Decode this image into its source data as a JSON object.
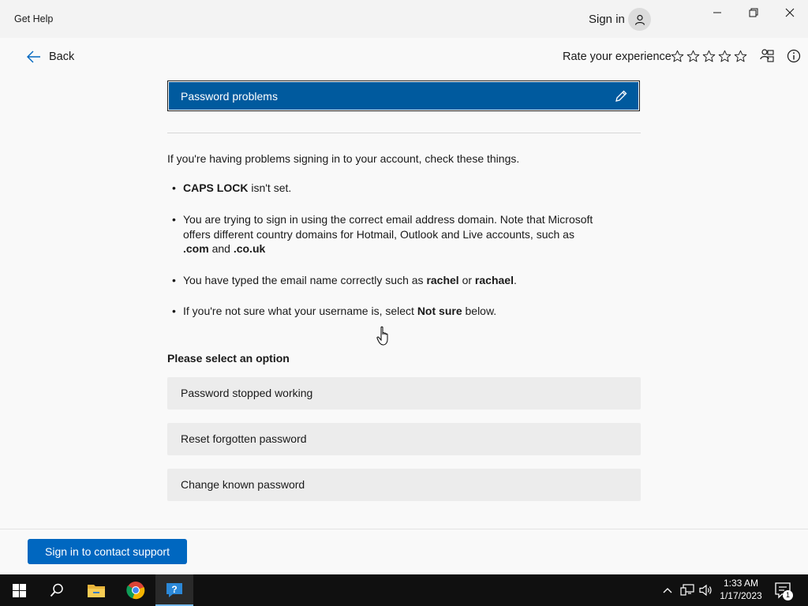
{
  "window": {
    "title": "Get Help",
    "sign_in_label": "Sign in"
  },
  "topbar": {
    "back_label": "Back",
    "rate_label": "Rate your experience",
    "star_count": 5
  },
  "banner": {
    "title": "Password problems"
  },
  "content": {
    "intro": "If you're having problems signing in to your account, check these things.",
    "bullets": [
      {
        "parts": [
          {
            "text": "CAPS LOCK",
            "bold": true
          },
          {
            "text": " isn't set.",
            "bold": false
          }
        ]
      },
      {
        "parts": [
          {
            "text": "You are trying to sign in using the correct email address domain. Note that Microsoft offers different country domains for Hotmail, Outlook and Live accounts, such as ",
            "bold": false
          },
          {
            "text": ".com",
            "bold": true
          },
          {
            "text": " and ",
            "bold": false
          },
          {
            "text": ".co.uk",
            "bold": true
          }
        ]
      },
      {
        "parts": [
          {
            "text": "You have typed the email name correctly such as ",
            "bold": false
          },
          {
            "text": "rachel",
            "bold": true
          },
          {
            "text": " or ",
            "bold": false
          },
          {
            "text": "rachael",
            "bold": true
          },
          {
            "text": ".",
            "bold": false
          }
        ]
      },
      {
        "parts": [
          {
            "text": "If you're not sure what your username is, select ",
            "bold": false
          },
          {
            "text": "Not sure",
            "bold": true
          },
          {
            "text": " below.",
            "bold": false
          }
        ]
      }
    ]
  },
  "options": {
    "heading": "Please select an option",
    "items": [
      {
        "label": "Password stopped working"
      },
      {
        "label": "Reset forgotten password"
      },
      {
        "label": "Change known password"
      }
    ]
  },
  "footer": {
    "contact_button": "Sign in to contact support"
  },
  "taskbar": {
    "apps": [
      "start-icon",
      "search-icon",
      "file-explorer-icon",
      "chrome-icon",
      "get-help-icon"
    ],
    "time": "1:33 AM",
    "date": "1/17/2023",
    "notification_count": "1"
  },
  "colors": {
    "banner": "#005a9e",
    "primary_button": "#0067c0",
    "option_bg": "#ececec",
    "taskbar": "#101010"
  }
}
